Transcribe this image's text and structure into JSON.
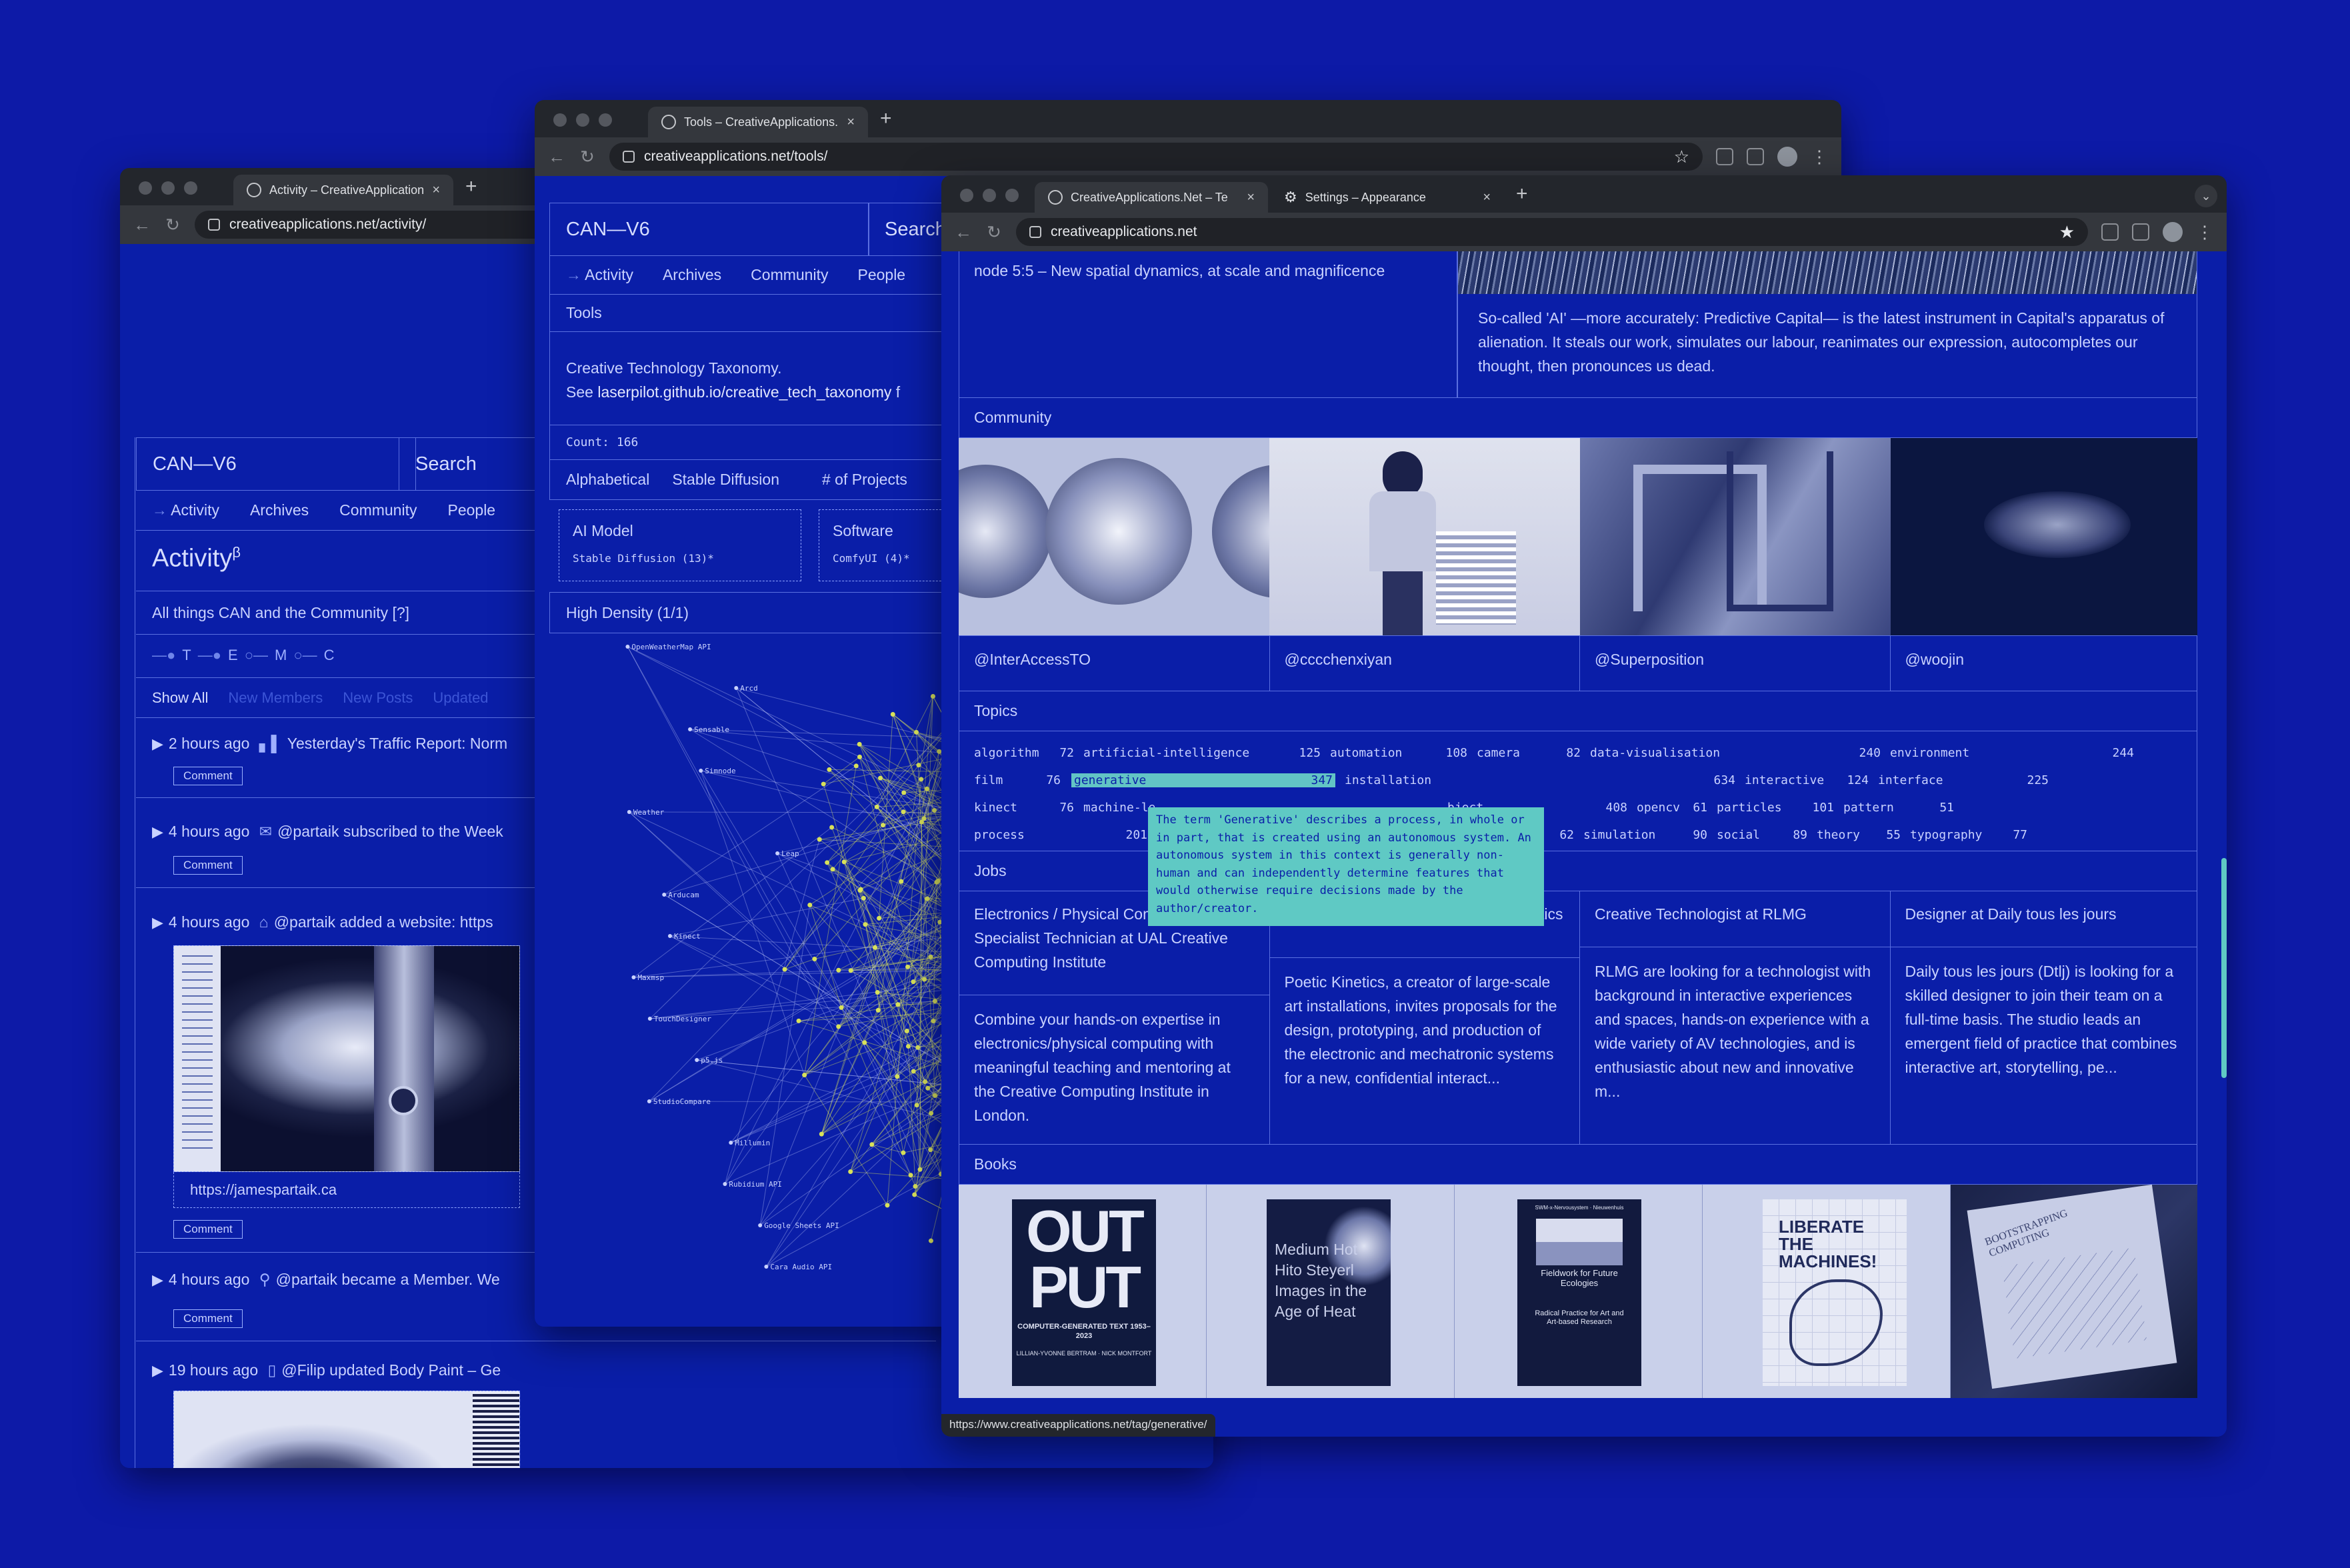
{
  "colors": {
    "background": "#0d1aa7",
    "page": "#0a1ea8",
    "tooltip": "#5fc9c4",
    "graph": "#d8e15a",
    "highlight": "#62c4c5"
  },
  "win1": {
    "tab": "Activity – CreativeApplication",
    "url": "creativeapplications.net/activity/",
    "logo": "CAN—V6",
    "search": "Search",
    "nav": [
      "Activity",
      "Archives",
      "Community",
      "People"
    ],
    "title": "Activity",
    "beta": "β",
    "desc": "All things CAN and the Community [?]",
    "filter_letters": [
      "T",
      "E",
      "M",
      "C"
    ],
    "filters": [
      "Show All",
      "New Members",
      "New Posts",
      "Updated"
    ],
    "items": [
      {
        "time": "2 hours ago",
        "text": "Yesterday's Traffic Report: Norm",
        "icon": "bar-chart-icon"
      },
      {
        "time": "4 hours ago",
        "text": "@partaik subscribed to the Week",
        "icon": "mail-icon"
      },
      {
        "time": "4 hours ago",
        "text": "@partaik added a website: https",
        "icon": "home-icon",
        "link": "https://jamespartaik.ca"
      },
      {
        "time": "4 hours ago",
        "text": "@partaik became a Member. We",
        "icon": "user-icon"
      },
      {
        "time": "19 hours ago",
        "text": "@Filip updated Body Paint – Ge",
        "icon": "document-icon"
      }
    ],
    "comment": "Comment"
  },
  "win2": {
    "tab": "Tools – CreativeApplications.",
    "url": "creativeapplications.net/tools/",
    "logo": "CAN—V6",
    "search": "Search",
    "nav": [
      "Activity",
      "Archives",
      "Community",
      "People"
    ],
    "section": "Tools",
    "taxonomy_line1": "Creative Technology Taxonomy.",
    "taxonomy_line2_pre": "See ",
    "taxonomy_link": "laserpilot.github.io/creative_tech_taxonomy",
    "taxonomy_line2_post": " f",
    "count": "Count: 166",
    "sorts": [
      "Alphabetical",
      "Stable Diffusion",
      "# of Projects"
    ],
    "box1_title": "AI Model",
    "box1_sub": "Stable Diffusion (13)*",
    "box2_title": "Software",
    "box2_sub": "ComfyUI (4)*",
    "density": "High Density (1/1)",
    "graph_labels": [
      "OpenWeatherMap API",
      "Arcd",
      "Sensable",
      "Simnode",
      "Weather",
      "Leap",
      "Arducam",
      "Kinect",
      "Maxmsp",
      "TouchDesigner",
      "p5.js",
      "StudioCompare",
      "Millumin",
      "Rubidium API",
      "Google Sheets API",
      "Cara Audio API"
    ]
  },
  "win3": {
    "tab1": "CreativeApplications.Net – Te",
    "tab2": "Settings – Appearance",
    "url": "creativeapplications.net",
    "node_text": "node 5:5 – New spatial dynamics, at scale and magnificence",
    "essay": "So-called 'AI' —more accurately: Predictive Capital— is the latest instrument in Capital's apparatus of alienation. It steals our work, simulates our labour, reanimates our expression, autocompletes our thought, then pronounces us dead.",
    "community_label": "Community",
    "community": [
      "@InterAccessTO",
      "@cccchenxiyan",
      "@Superposition",
      "@woojin"
    ],
    "topics_label": "Topics",
    "topics": [
      [
        {
          "t": "algorithm",
          "n": "72"
        },
        {
          "t": "artificial-intelligence",
          "n": "125"
        },
        {
          "t": "automation",
          "n": "108"
        },
        {
          "t": "camera",
          "n": "82"
        },
        {
          "t": "data-visualisation",
          "n": "240"
        },
        {
          "t": "environment",
          "n": "244"
        }
      ],
      [
        {
          "t": "film",
          "n": "76"
        },
        {
          "t": "generative",
          "n": "347"
        },
        {
          "t": "installation",
          "n": ""
        },
        {
          "t": "",
          "n": "634"
        },
        {
          "t": "interactive",
          "n": "124"
        },
        {
          "t": "interface",
          "n": "225"
        }
      ],
      [
        {
          "t": "kinect",
          "n": "76"
        },
        {
          "t": "machine-le",
          "n": ""
        },
        {
          "t": "bject",
          "n": "408"
        },
        {
          "t": "opencv",
          "n": "61"
        },
        {
          "t": "particles",
          "n": "101"
        },
        {
          "t": "pattern",
          "n": "51"
        }
      ],
      [
        {
          "t": "process",
          "n": "201"
        },
        {
          "t": "e",
          "n": "62"
        },
        {
          "t": "simulation",
          "n": "90"
        },
        {
          "t": "social",
          "n": "89"
        },
        {
          "t": "theory",
          "n": "55"
        },
        {
          "t": "typography",
          "n": "77"
        }
      ]
    ],
    "tooltip": "The term 'Generative' describes a process, in whole or in part, that is created using an autonomous system. An autonomous system in this context is generally non-human and can independently determine features that would otherwise require decisions made by the author/creator.",
    "jobs_label": "Jobs",
    "jobs": [
      {
        "title": "Electronics / Physical Computing Specialist Technician at UAL Creative Computing Institute",
        "desc": "Combine your hands-on expertise in electronics/physical computing with meaningful teaching and mentoring at the Creative Computing Institute in London."
      },
      {
        "title": "Mechatronics Engineer at Poetic Kinetics",
        "desc": "Poetic Kinetics, a creator of large-scale art installations, invites proposals for the design, prototyping, and production of the electronic and mechatronic systems for a new, confidential interact..."
      },
      {
        "title": "Creative Technologist at RLMG",
        "desc": "RLMG are looking for a technologist with background in interactive experiences and spaces, hands-on experience with a wide variety of AV technologies, and is enthusiastic about new and innovative m..."
      },
      {
        "title": "Designer at Daily tous les jours",
        "desc": "Daily tous les jours (Dtlj) is looking for a skilled designer to join their team on a full-time basis. The studio leads an emergent field of practice that combines interactive art, storytelling, pe..."
      }
    ],
    "books_label": "Books",
    "book1": {
      "big": "OUT PUT",
      "sub": "COMPUTER-GENERATED TEXT 1953–2023",
      "authors": "LILLIAN-YVONNE BERTRAM · NICK MONTFORT"
    },
    "book2": {
      "text": "Medium Hot Hito Steyerl Images in the Age of Heat"
    },
    "book3": {
      "top": "SWM-x-Nervousystem · Nieuwenhuis",
      "title": "Fieldwork for Future Ecologies",
      "sub": "Radical Practice for Art and Art-based Research"
    },
    "book4": {
      "text": "LIBERATE THE MACHINES!"
    },
    "book5": {
      "text": "BOOTSTRAPPING COMPUTING"
    },
    "status_url": "https://www.creativeapplications.net/tag/generative/"
  }
}
